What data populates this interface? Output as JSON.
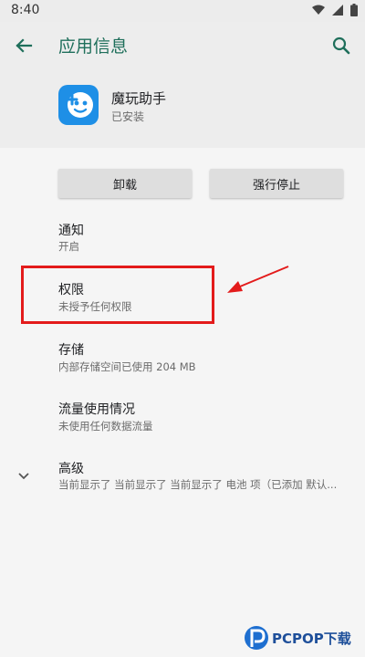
{
  "status_bar": {
    "time": "8:40"
  },
  "header": {
    "title": "应用信息"
  },
  "app": {
    "name": "魔玩助手",
    "status": "已安装"
  },
  "buttons": {
    "uninstall": "卸载",
    "force_stop": "强行停止"
  },
  "items": [
    {
      "title": "通知",
      "subtitle": "开启"
    },
    {
      "title": "权限",
      "subtitle": "未授予任何权限"
    },
    {
      "title": "存储",
      "subtitle": "内部存储空间已使用 204 MB"
    },
    {
      "title": "流量使用情况",
      "subtitle": "未使用任何数据流量"
    },
    {
      "title": "高级",
      "subtitle": "当前显示了 当前显示了 当前显示了 电池 项（已添加 默认..."
    }
  ],
  "watermark": {
    "logo_text": "PCPOP下载"
  },
  "colors": {
    "accent": "#1f6f5b",
    "highlight": "#e31b1b",
    "app_icon": "#1e8fe6"
  }
}
